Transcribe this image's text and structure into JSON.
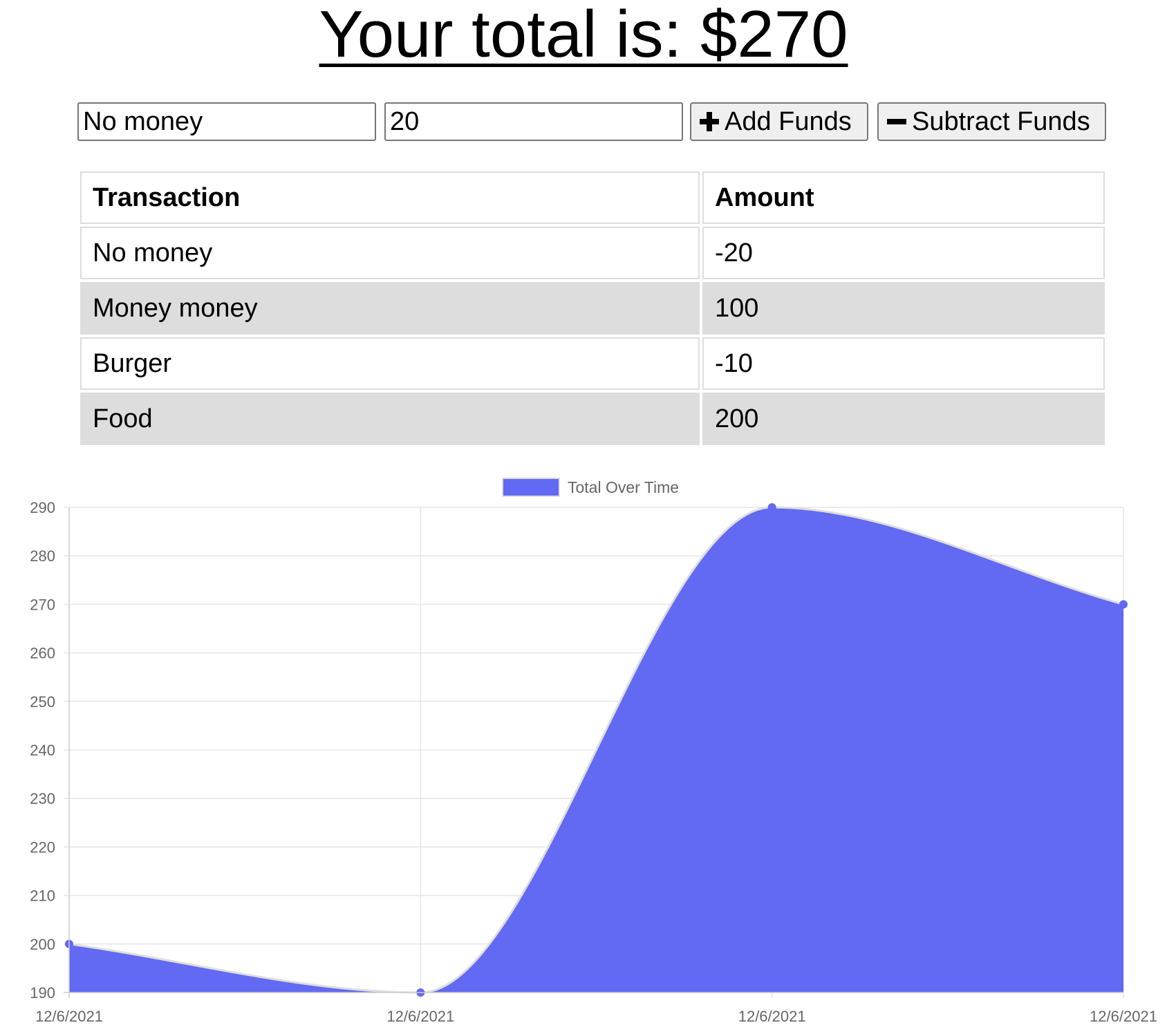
{
  "header": {
    "title": "Your total is: $270"
  },
  "form": {
    "name_value": "No money",
    "amount_value": "20",
    "add_label": "Add Funds",
    "subtract_label": "Subtract Funds",
    "add_icon": "plus-icon",
    "subtract_icon": "minus-icon"
  },
  "table": {
    "headers": [
      "Transaction",
      "Amount"
    ],
    "rows": [
      {
        "name": "No money",
        "amount": "-20"
      },
      {
        "name": "Money money",
        "amount": "100"
      },
      {
        "name": "Burger",
        "amount": "-10"
      },
      {
        "name": "Food",
        "amount": "200"
      }
    ]
  },
  "chart_data": {
    "type": "area",
    "categories": [
      "12/6/2021",
      "12/6/2021",
      "12/6/2021",
      "12/6/2021"
    ],
    "series": [
      {
        "name": "Total Over Time",
        "values": [
          200,
          190,
          290,
          270
        ],
        "color": "#6269f2"
      }
    ],
    "title": "",
    "xlabel": "",
    "ylabel": "",
    "ylim": [
      190,
      290
    ],
    "ytick_step": 10,
    "grid": true,
    "legend_position": "top-center",
    "line_color": "#dddddd",
    "grid_color": "#e5e5e5"
  }
}
